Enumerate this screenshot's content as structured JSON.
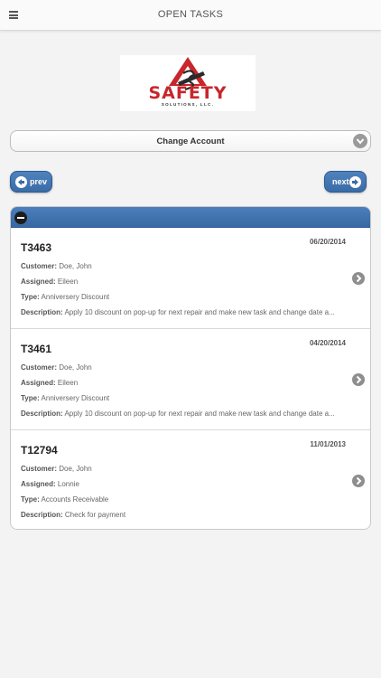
{
  "header": {
    "title": "OPEN TASKS"
  },
  "logo": {
    "word": "SAFETY",
    "sub": "SOLUTIONS, LLC."
  },
  "account_select": {
    "label": "Change Account"
  },
  "pager": {
    "prev_label": "prev",
    "next_label": "next"
  },
  "labels": {
    "customer": "Customer:",
    "assigned": "Assigned:",
    "type": "Type:",
    "description": "Description:"
  },
  "colors": {
    "accent": "#3f73b0",
    "logo_red": "#c8262b"
  },
  "tasks": [
    {
      "id": "T3463",
      "date": "06/20/2014",
      "customer": "Doe, John",
      "assigned": "Eileen",
      "type": "Anniversery Discount",
      "description": "Apply 10 discount on pop-up for next repair and make new task and change date a..."
    },
    {
      "id": "T3461",
      "date": "04/20/2014",
      "customer": "Doe, John",
      "assigned": "Eileen",
      "type": "Anniversery Discount",
      "description": "Apply 10 discount on pop-up for next repair and make new task and change date a..."
    },
    {
      "id": "T12794",
      "date": "11/01/2013",
      "customer": "Doe, John",
      "assigned": "Lonnie",
      "type": "Accounts Receivable",
      "description": "Check for payment"
    }
  ]
}
